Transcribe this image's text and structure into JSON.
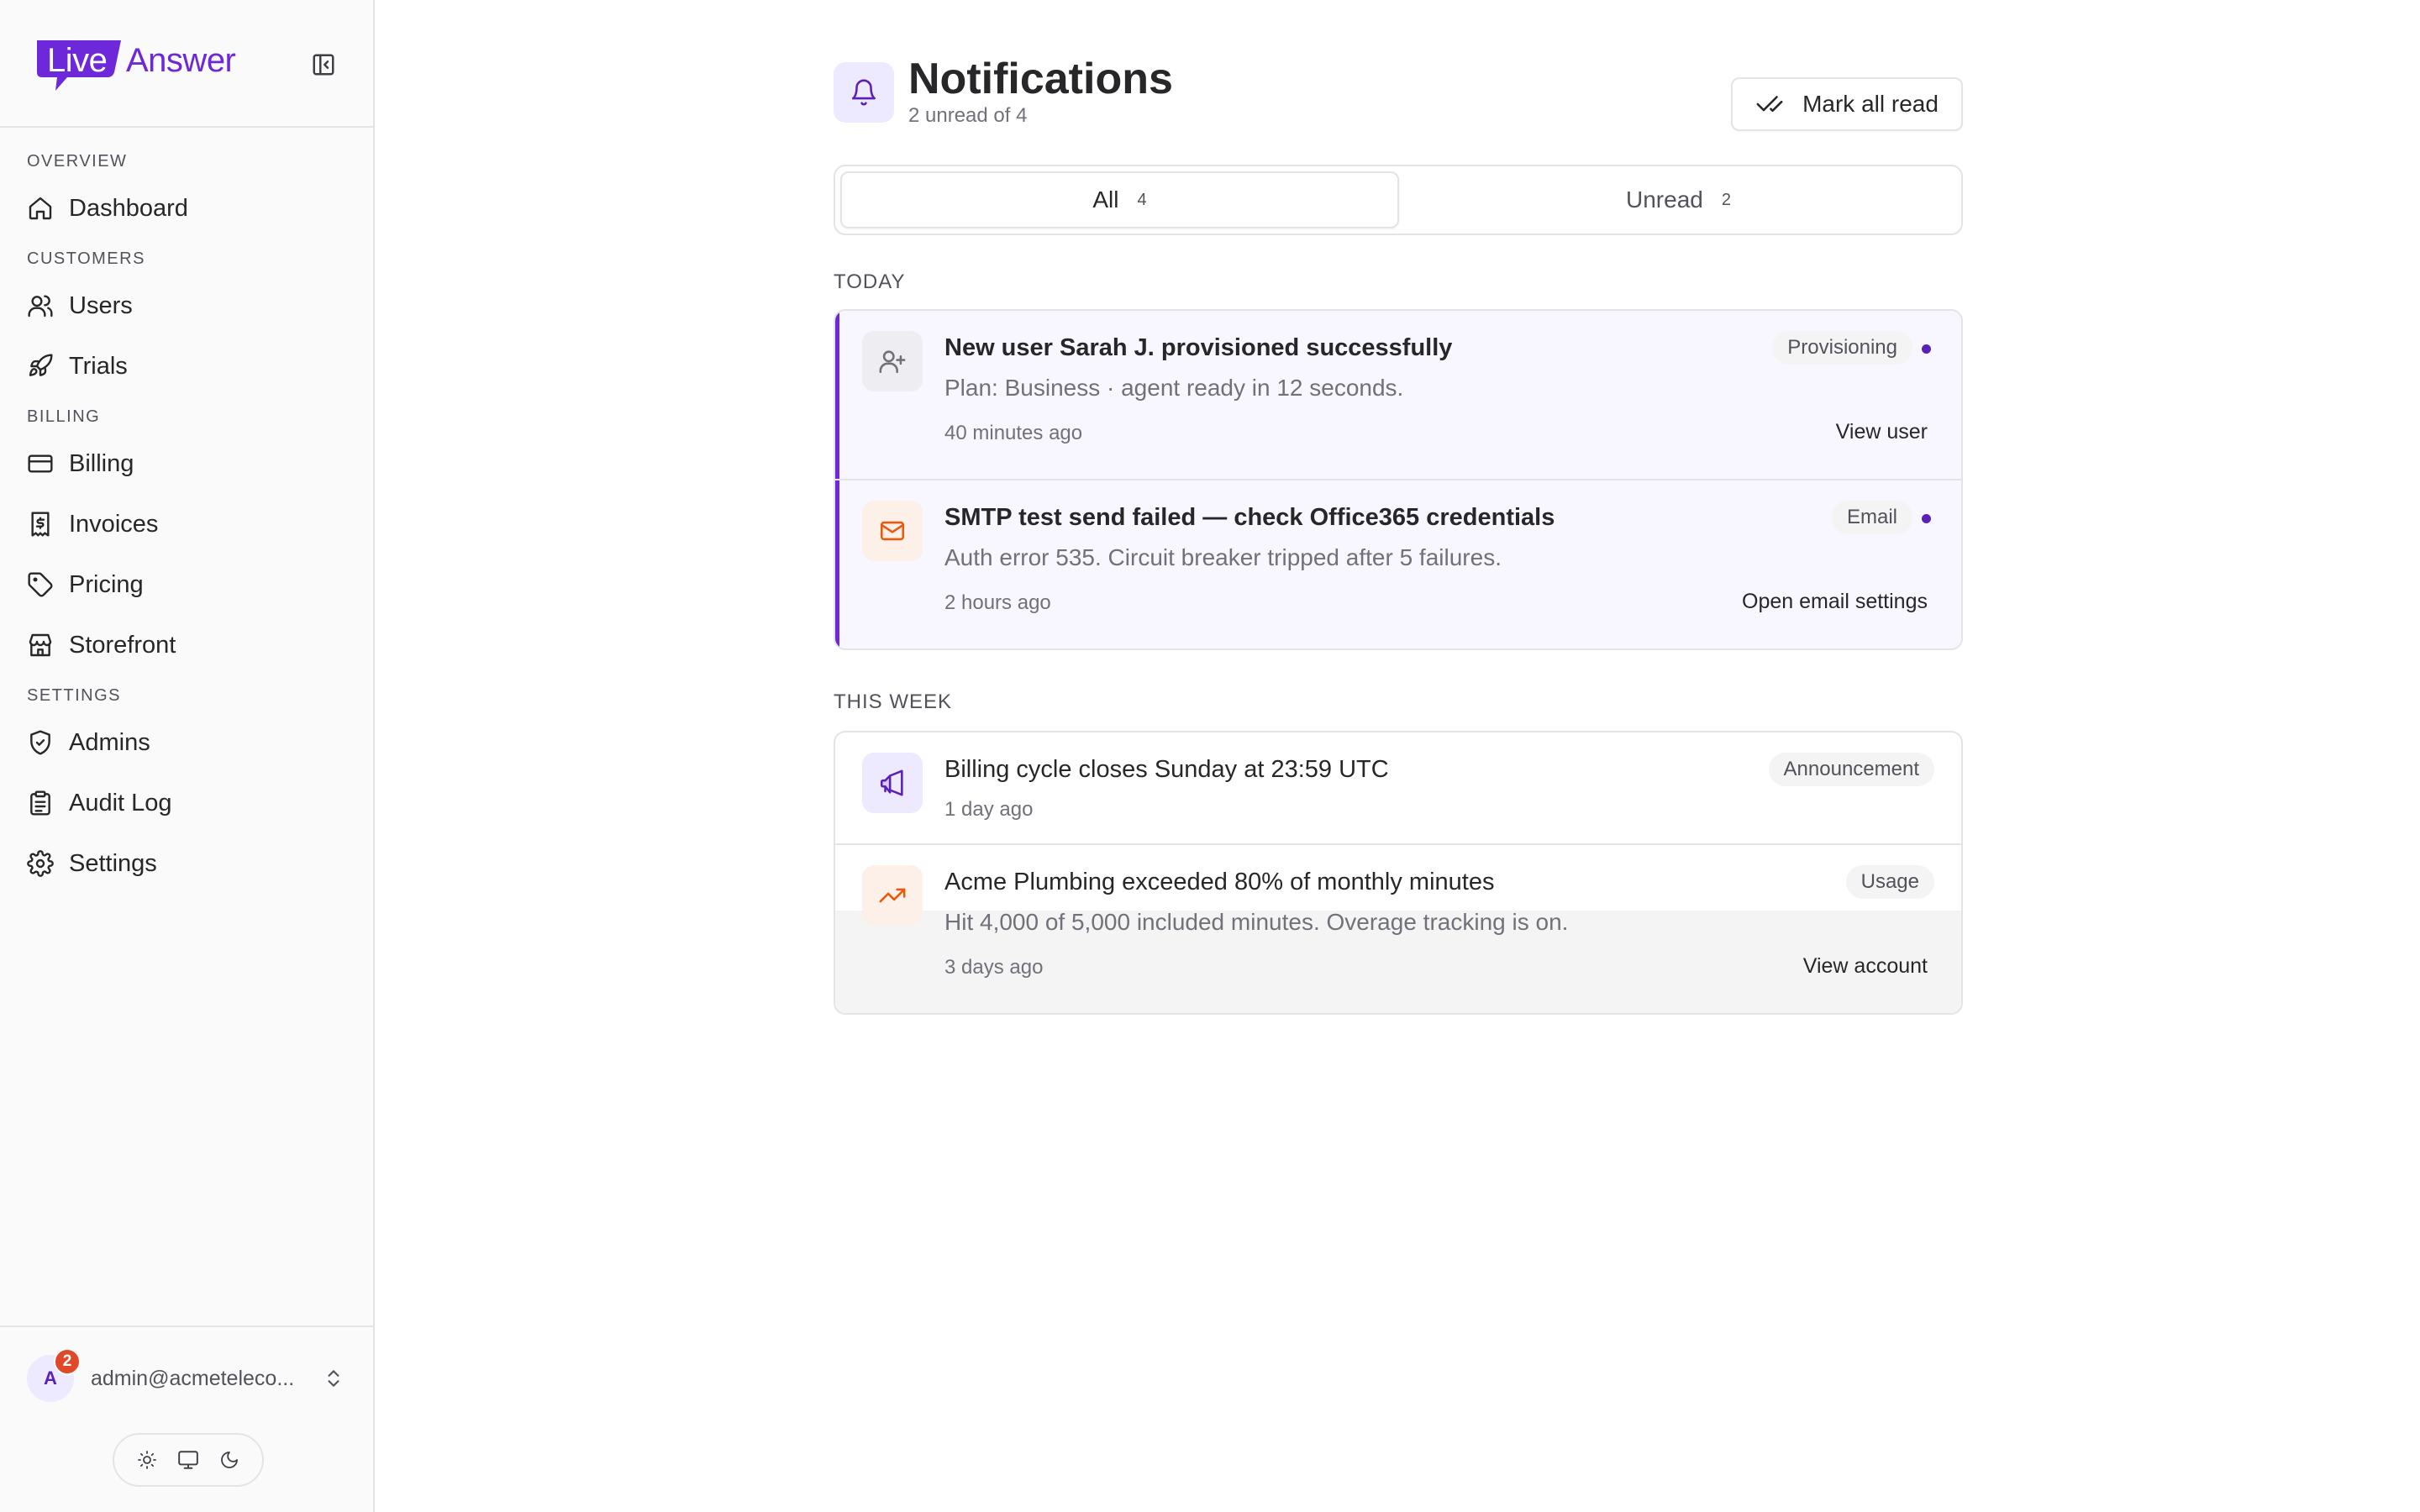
{
  "app": {
    "logo_live": "Live",
    "logo_answer": "Answer",
    "brand_color": "#6d28d9"
  },
  "sidebar": {
    "sections": [
      {
        "label": "OVERVIEW",
        "items": [
          {
            "label": "Dashboard",
            "icon": "home-icon"
          }
        ]
      },
      {
        "label": "CUSTOMERS",
        "items": [
          {
            "label": "Users",
            "icon": "users-icon"
          },
          {
            "label": "Trials",
            "icon": "rocket-icon"
          }
        ]
      },
      {
        "label": "BILLING",
        "items": [
          {
            "label": "Billing",
            "icon": "credit-card-icon"
          },
          {
            "label": "Invoices",
            "icon": "receipt-dollar-icon"
          },
          {
            "label": "Pricing",
            "icon": "tag-icon"
          },
          {
            "label": "Storefront",
            "icon": "store-icon"
          }
        ]
      },
      {
        "label": "SETTINGS",
        "items": [
          {
            "label": "Admins",
            "icon": "shield-check-icon"
          },
          {
            "label": "Audit Log",
            "icon": "clipboard-icon"
          },
          {
            "label": "Settings",
            "icon": "gear-icon"
          }
        ]
      }
    ],
    "user": {
      "avatar_initial": "A",
      "badge_count": "2",
      "email": "admin@acmeteleco..."
    }
  },
  "page": {
    "title": "Notifications",
    "subtitle": "2 unread of 4",
    "mark_all_label": "Mark all read",
    "tabs": [
      {
        "label": "All",
        "count": "4",
        "active": true
      },
      {
        "label": "Unread",
        "count": "2",
        "active": false
      }
    ],
    "groups": [
      {
        "label": "TODAY",
        "items": [
          {
            "title": "New user Sarah J. provisioned successfully",
            "description": "Plan: Business · agent ready in 12 seconds.",
            "time": "40 minutes ago",
            "tag": "Provisioning",
            "action": "View user",
            "unread": true,
            "icon": "user-plus-icon",
            "icon_color": "#71717a"
          },
          {
            "title": "SMTP test send failed — check Office365 credentials",
            "description": "Auth error 535. Circuit breaker tripped after 5 failures.",
            "time": "2 hours ago",
            "tag": "Email",
            "action": "Open email settings",
            "unread": true,
            "icon": "mail-icon",
            "icon_color": "#ea580c"
          }
        ]
      },
      {
        "label": "THIS WEEK",
        "items": [
          {
            "title": "Billing cycle closes Sunday at 23:59 UTC",
            "description": "",
            "time": "1 day ago",
            "tag": "Announcement",
            "action": "",
            "unread": false,
            "icon": "megaphone-icon",
            "icon_color": "#5b21b6"
          },
          {
            "title": "Acme Plumbing exceeded 80% of monthly minutes",
            "description": "Hit 4,000 of 5,000 included minutes. Overage tracking is on.",
            "time": "3 days ago",
            "tag": "Usage",
            "action": "View account",
            "unread": false,
            "icon": "trending-up-icon",
            "icon_color": "#ea580c"
          }
        ]
      }
    ]
  }
}
